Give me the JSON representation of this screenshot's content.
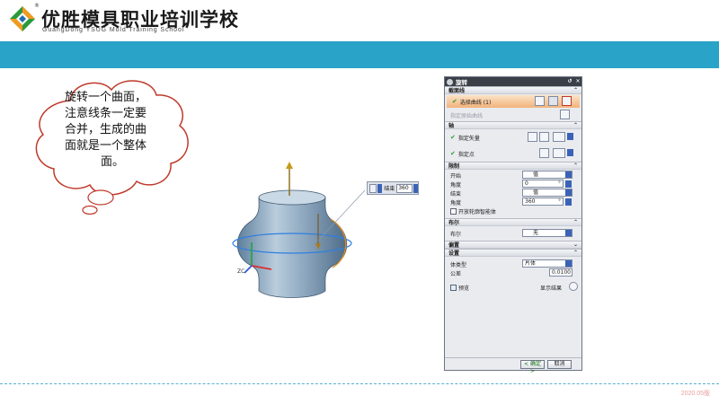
{
  "header": {
    "logo_cn": "优胜模具职业培训学校",
    "logo_en": "GuangDong YSUG Mold Training School",
    "registered_mark": "®",
    "band_color": "#29a3c7"
  },
  "callout": {
    "lines": [
      "旋转一个曲面，",
      "注意线条一定要",
      "合并，生成的曲",
      "面就是一个整体",
      "面。"
    ]
  },
  "viewport": {
    "axis_label": "ZC",
    "mini_toolbar": {
      "label": "结束",
      "value": "360"
    }
  },
  "dialog": {
    "title": "旋转",
    "sections": {
      "section_curve": "截面线",
      "select_curve": "选择曲线 (1)",
      "origin_curve": "指定原始曲线",
      "axis": "轴",
      "vector": "指定矢量",
      "point": "指定点",
      "limits": "限制",
      "start": "开始",
      "start_type": "值",
      "angle1": "角度",
      "angle1_value": "0",
      "end": "结束",
      "end_type": "值",
      "angle2": "角度",
      "angle2_value": "360",
      "open_profile": "开放轮廓智能体",
      "boolean": "布尔",
      "boolean_label": "布尔",
      "boolean_value": "无",
      "offset": "偏置",
      "settings": "设置",
      "body_type": "体类型",
      "body_type_value": "片体",
      "tolerance": "公差",
      "tolerance_value": "0.0100",
      "preview": "预览",
      "show_result": "显示结果",
      "unit_deg": "°"
    },
    "buttons": {
      "ok": "< 确定 >",
      "cancel": "取消"
    }
  },
  "footer": {
    "version": "2020.05版"
  },
  "colors": {
    "accent_band": "#29a3c7",
    "model_body": "#8fa9c0",
    "selected_row": "#f2b27a",
    "dropdown_arrow": "#3a63b8"
  }
}
